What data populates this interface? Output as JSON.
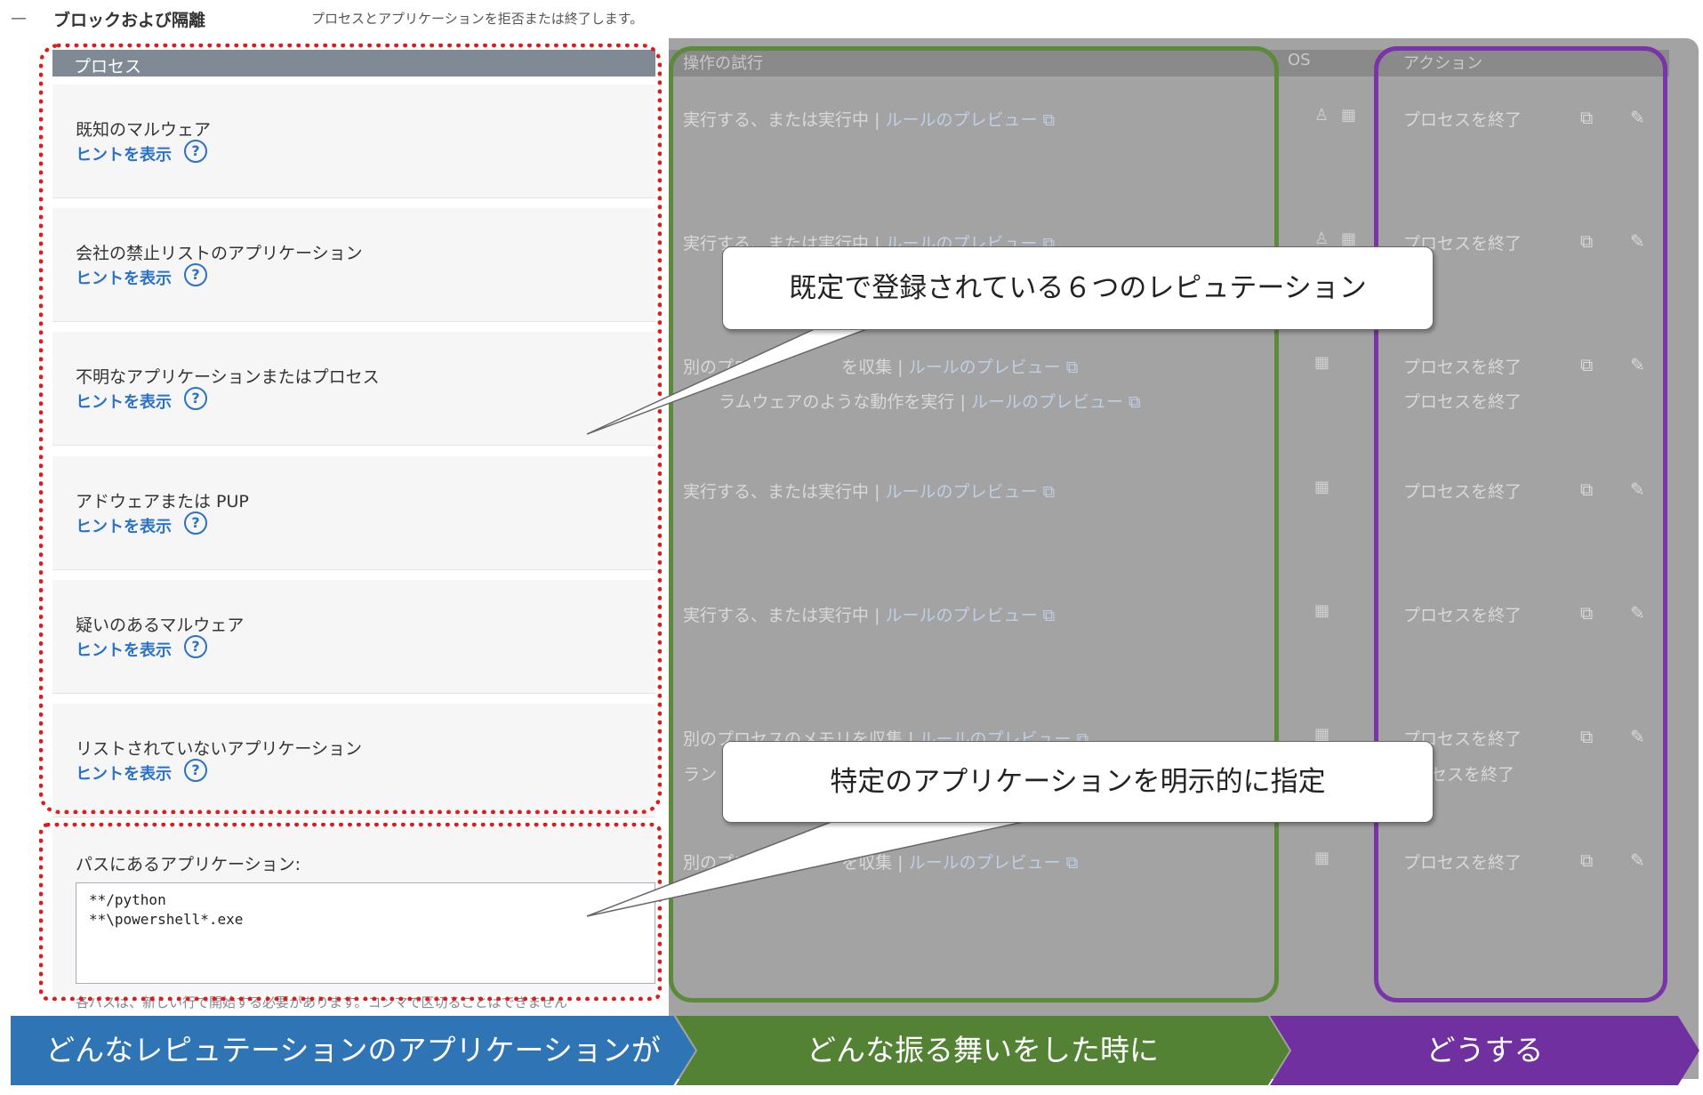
{
  "header": {
    "dash": "—",
    "title": "ブロックおよび隔離",
    "description": "プロセスとアプリケーションを拒否または終了します。"
  },
  "columns": {
    "process": "プロセス",
    "operation": "操作の試行",
    "os": "OS",
    "action": "アクション"
  },
  "hint_label": "ヒントを表示",
  "rows": [
    {
      "name": "既知のマルウェア",
      "operations": [
        {
          "text": "実行する、または実行中",
          "link": "ルールのプレビュー"
        }
      ],
      "os": [
        "apple",
        "linux",
        "windows"
      ],
      "actions": [
        "プロセスを終了"
      ]
    },
    {
      "name": "会社の禁止リストのアプリケーション",
      "operations": [
        {
          "text": "実行する、または実行中",
          "link": "ルールのプレビュー"
        }
      ],
      "os": [
        "apple",
        "linux",
        "windows"
      ],
      "actions": [
        "プロセスを終了"
      ]
    },
    {
      "name": "不明なアプリケーションまたはプロセス",
      "operations": [
        {
          "text": "別のプロ",
          "text2": "を収集",
          "link": "ルールのプレビュー"
        },
        {
          "text": "ラムウェアのような動作を実行",
          "link": "ルールのプレビュー"
        }
      ],
      "os": [
        "apple",
        "windows"
      ],
      "actions": [
        "プロセスを終了",
        "プロセスを終了"
      ]
    },
    {
      "name": "アドウェアまたは PUP",
      "operations": [
        {
          "text": "実行する、または実行中",
          "link": "ルールのプレビュー"
        }
      ],
      "os": [
        "apple",
        "windows"
      ],
      "actions": [
        "プロセスを終了"
      ]
    },
    {
      "name": "疑いのあるマルウェア",
      "operations": [
        {
          "text": "実行する、または実行中",
          "link": "ルールのプレビュー"
        }
      ],
      "os": [
        "apple",
        "windows"
      ],
      "actions": [
        "プロセスを終了"
      ]
    },
    {
      "name": "リストされていないアプリケーション",
      "operations": [
        {
          "text": "別のプロセスのメモリを収集",
          "link": "ルールのプレビュー"
        },
        {
          "text": "ラン",
          "link": ""
        }
      ],
      "os": [
        "apple",
        "windows"
      ],
      "actions": [
        "プロセスを終了",
        "セスを終了"
      ]
    }
  ],
  "path": {
    "label": "パスにあるアプリケーション:",
    "value": "**/python\n**\\powershell*.exe",
    "note": "各パスは、新しい行で開始する必要があります。コンマで区切ることはできません",
    "operation": {
      "text": "別のプロ",
      "text2": "を収集",
      "link": "ルールのプレビュー"
    },
    "action": "プロセスを終了"
  },
  "callouts": {
    "top": "既定で登録されている６つのレピュテーション",
    "bottom": "特定のアプリケーションを明示的に指定"
  },
  "arrows": {
    "blue": "どんなレピュテーションのアプリケーションが",
    "green": "どんな振る舞いをした時に",
    "purple": "どうする"
  },
  "colors": {
    "red_dotted": "#e31a1a",
    "green": "#548235",
    "purple": "#7030a0",
    "blue": "#2f74b5",
    "link": "#2a72c8"
  },
  "icons": {
    "apple": "apple-icon",
    "linux": "linux-icon",
    "windows": "windows-icon",
    "copy": "copy-icon",
    "edit": "edit-icon",
    "external": "external-link-icon",
    "help": "help-icon"
  }
}
